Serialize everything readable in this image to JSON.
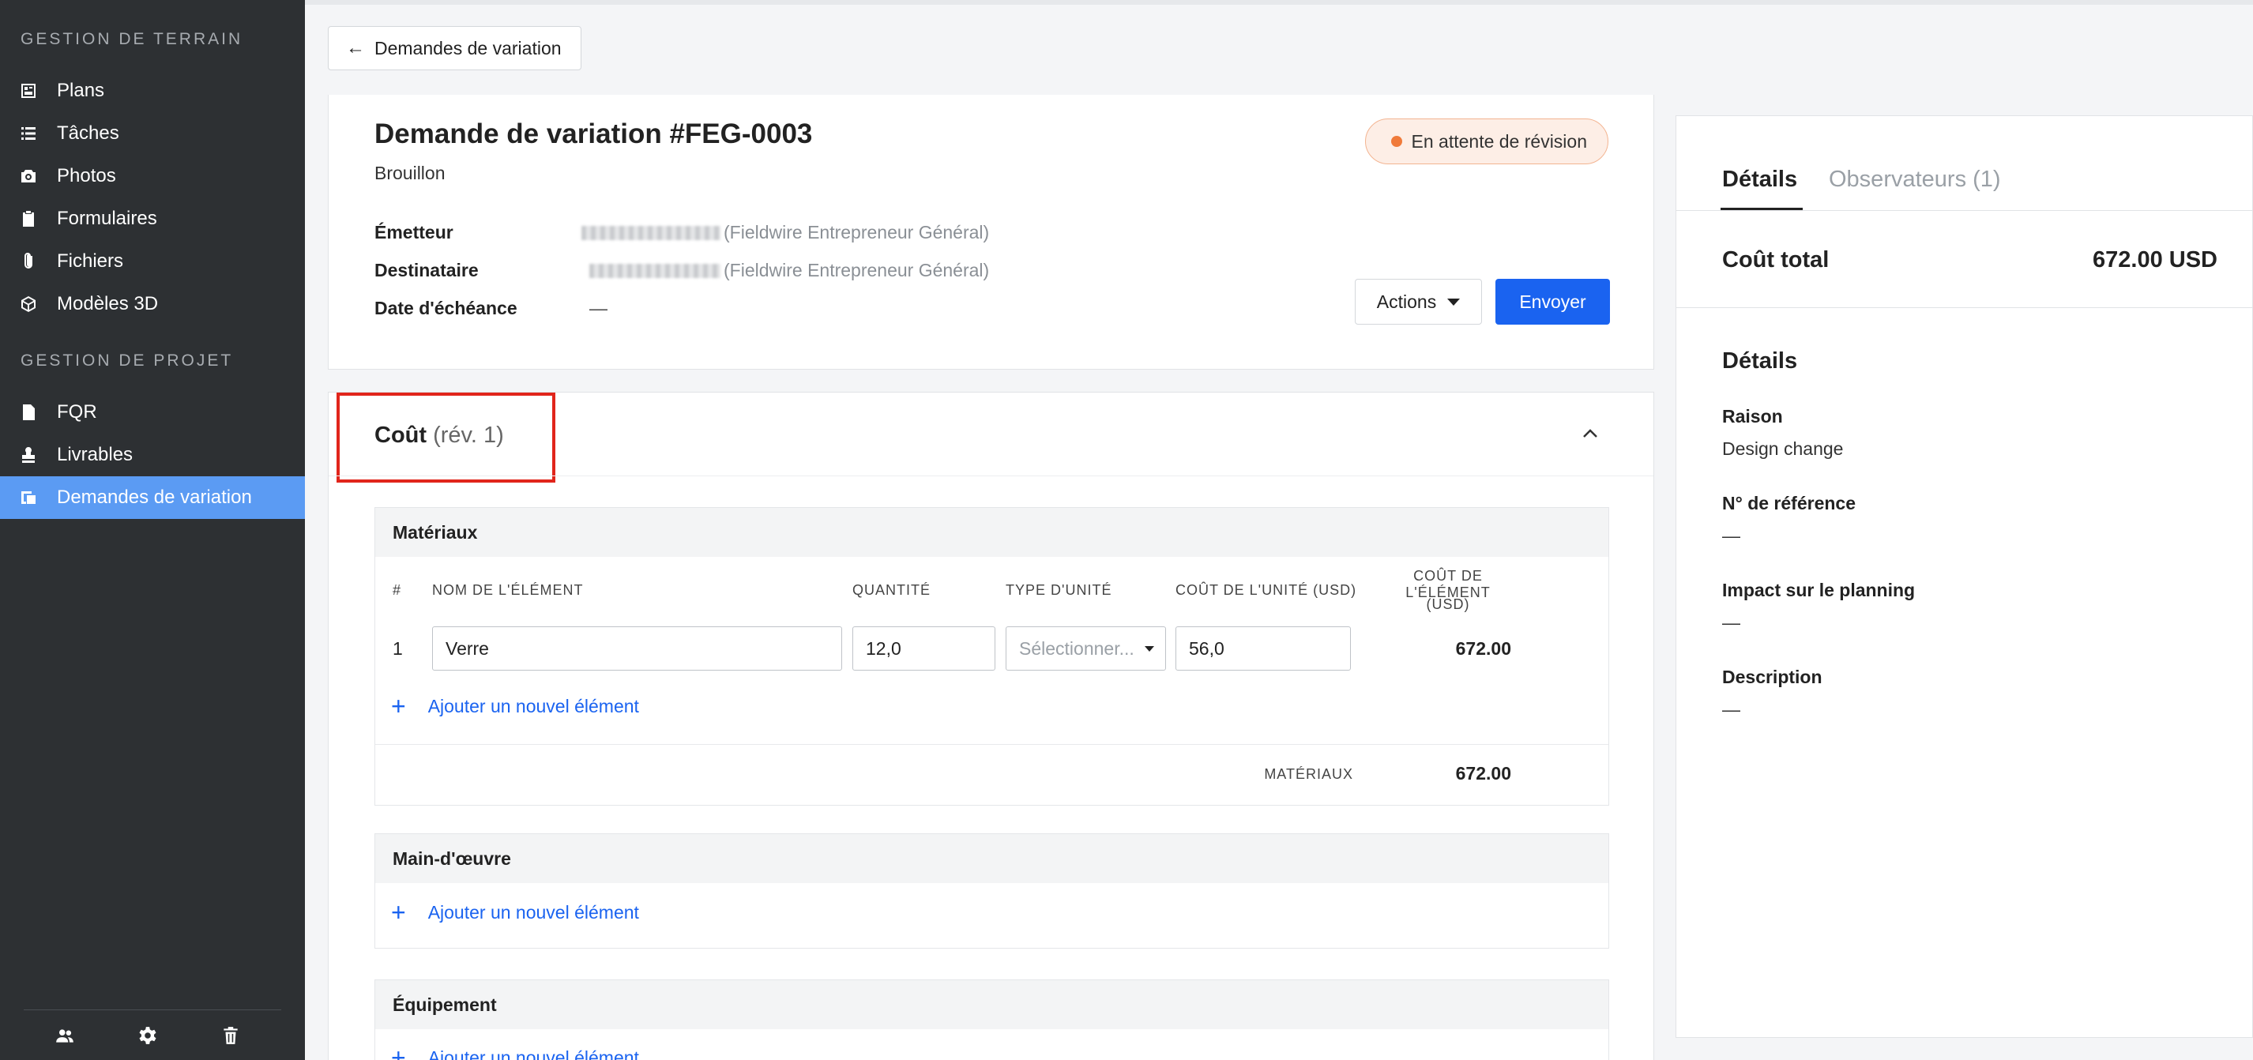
{
  "sidebar": {
    "section_field": "GESTION DE TERRAIN",
    "section_project": "GESTION DE PROJET",
    "items": [
      {
        "label": "Plans",
        "icon": "plans-icon"
      },
      {
        "label": "Tâches",
        "icon": "list-icon"
      },
      {
        "label": "Photos",
        "icon": "camera-icon"
      },
      {
        "label": "Formulaires",
        "icon": "clipboard-icon"
      },
      {
        "label": "Fichiers",
        "icon": "paperclip-icon"
      },
      {
        "label": "Modèles 3D",
        "icon": "cube-icon"
      },
      {
        "label": "FQR",
        "icon": "document-info-icon"
      },
      {
        "label": "Livrables",
        "icon": "stamp-icon"
      },
      {
        "label": "Demandes de variation",
        "icon": "change-order-icon",
        "active": true
      }
    ],
    "bottom_icons": [
      "people-icon",
      "gear-icon",
      "trash-icon"
    ],
    "active_color": "#5b9bf3"
  },
  "header": {
    "back_label": "Demandes de variation"
  },
  "request": {
    "title": "Demande de variation #FEG-0003",
    "subtitle": "Brouillon",
    "status": "En attente de révision",
    "status_color": "#f07a3a",
    "meta": {
      "issuer_label": "Émetteur",
      "issuer_company": "(Fieldwire Entrepreneur Général)",
      "recipient_label": "Destinataire",
      "recipient_company": "(Fieldwire Entrepreneur Général)",
      "due_label": "Date d'échéance",
      "due_value": "—"
    },
    "actions_label": "Actions",
    "send_label": "Envoyer",
    "send_color": "#1a63f0"
  },
  "cost": {
    "title": "Coût",
    "revision": "(rév. 1)",
    "materials": {
      "title": "Matériaux",
      "columns": {
        "num": "#",
        "name": "NOM DE L'ÉLÉMENT",
        "qty": "QUANTITÉ",
        "unit_type": "TYPE D'UNITÉ",
        "unit_cost": "COÛT DE L'UNITÉ (USD)",
        "item_cost_1": "COÛT DE L'ÉLÉMENT",
        "item_cost_2": "(USD)"
      },
      "rows": [
        {
          "num": "1",
          "name": "Verre",
          "qty": "12,0",
          "unit_type_placeholder": "Sélectionner...",
          "unit_cost": "56,0",
          "total": "672.00"
        }
      ],
      "add_label": "Ajouter un nouvel élément",
      "sum_label": "MATÉRIAUX",
      "sum_value": "672.00"
    },
    "labor": {
      "title": "Main-d'œuvre",
      "add_label": "Ajouter un nouvel élément"
    },
    "equipment": {
      "title": "Équipement",
      "add_label": "Ajouter un nouvel élément"
    }
  },
  "details_panel": {
    "tab_details": "Détails",
    "tab_watchers": "Observateurs (1)",
    "total_label": "Coût total",
    "total_value": "672.00 USD",
    "section_title": "Détails",
    "fields": [
      {
        "label": "Raison",
        "value": "Design change"
      },
      {
        "label": "N° de référence",
        "value": "—"
      },
      {
        "label": "Impact sur le planning",
        "value": "—"
      },
      {
        "label": "Description",
        "value": "—"
      }
    ]
  }
}
